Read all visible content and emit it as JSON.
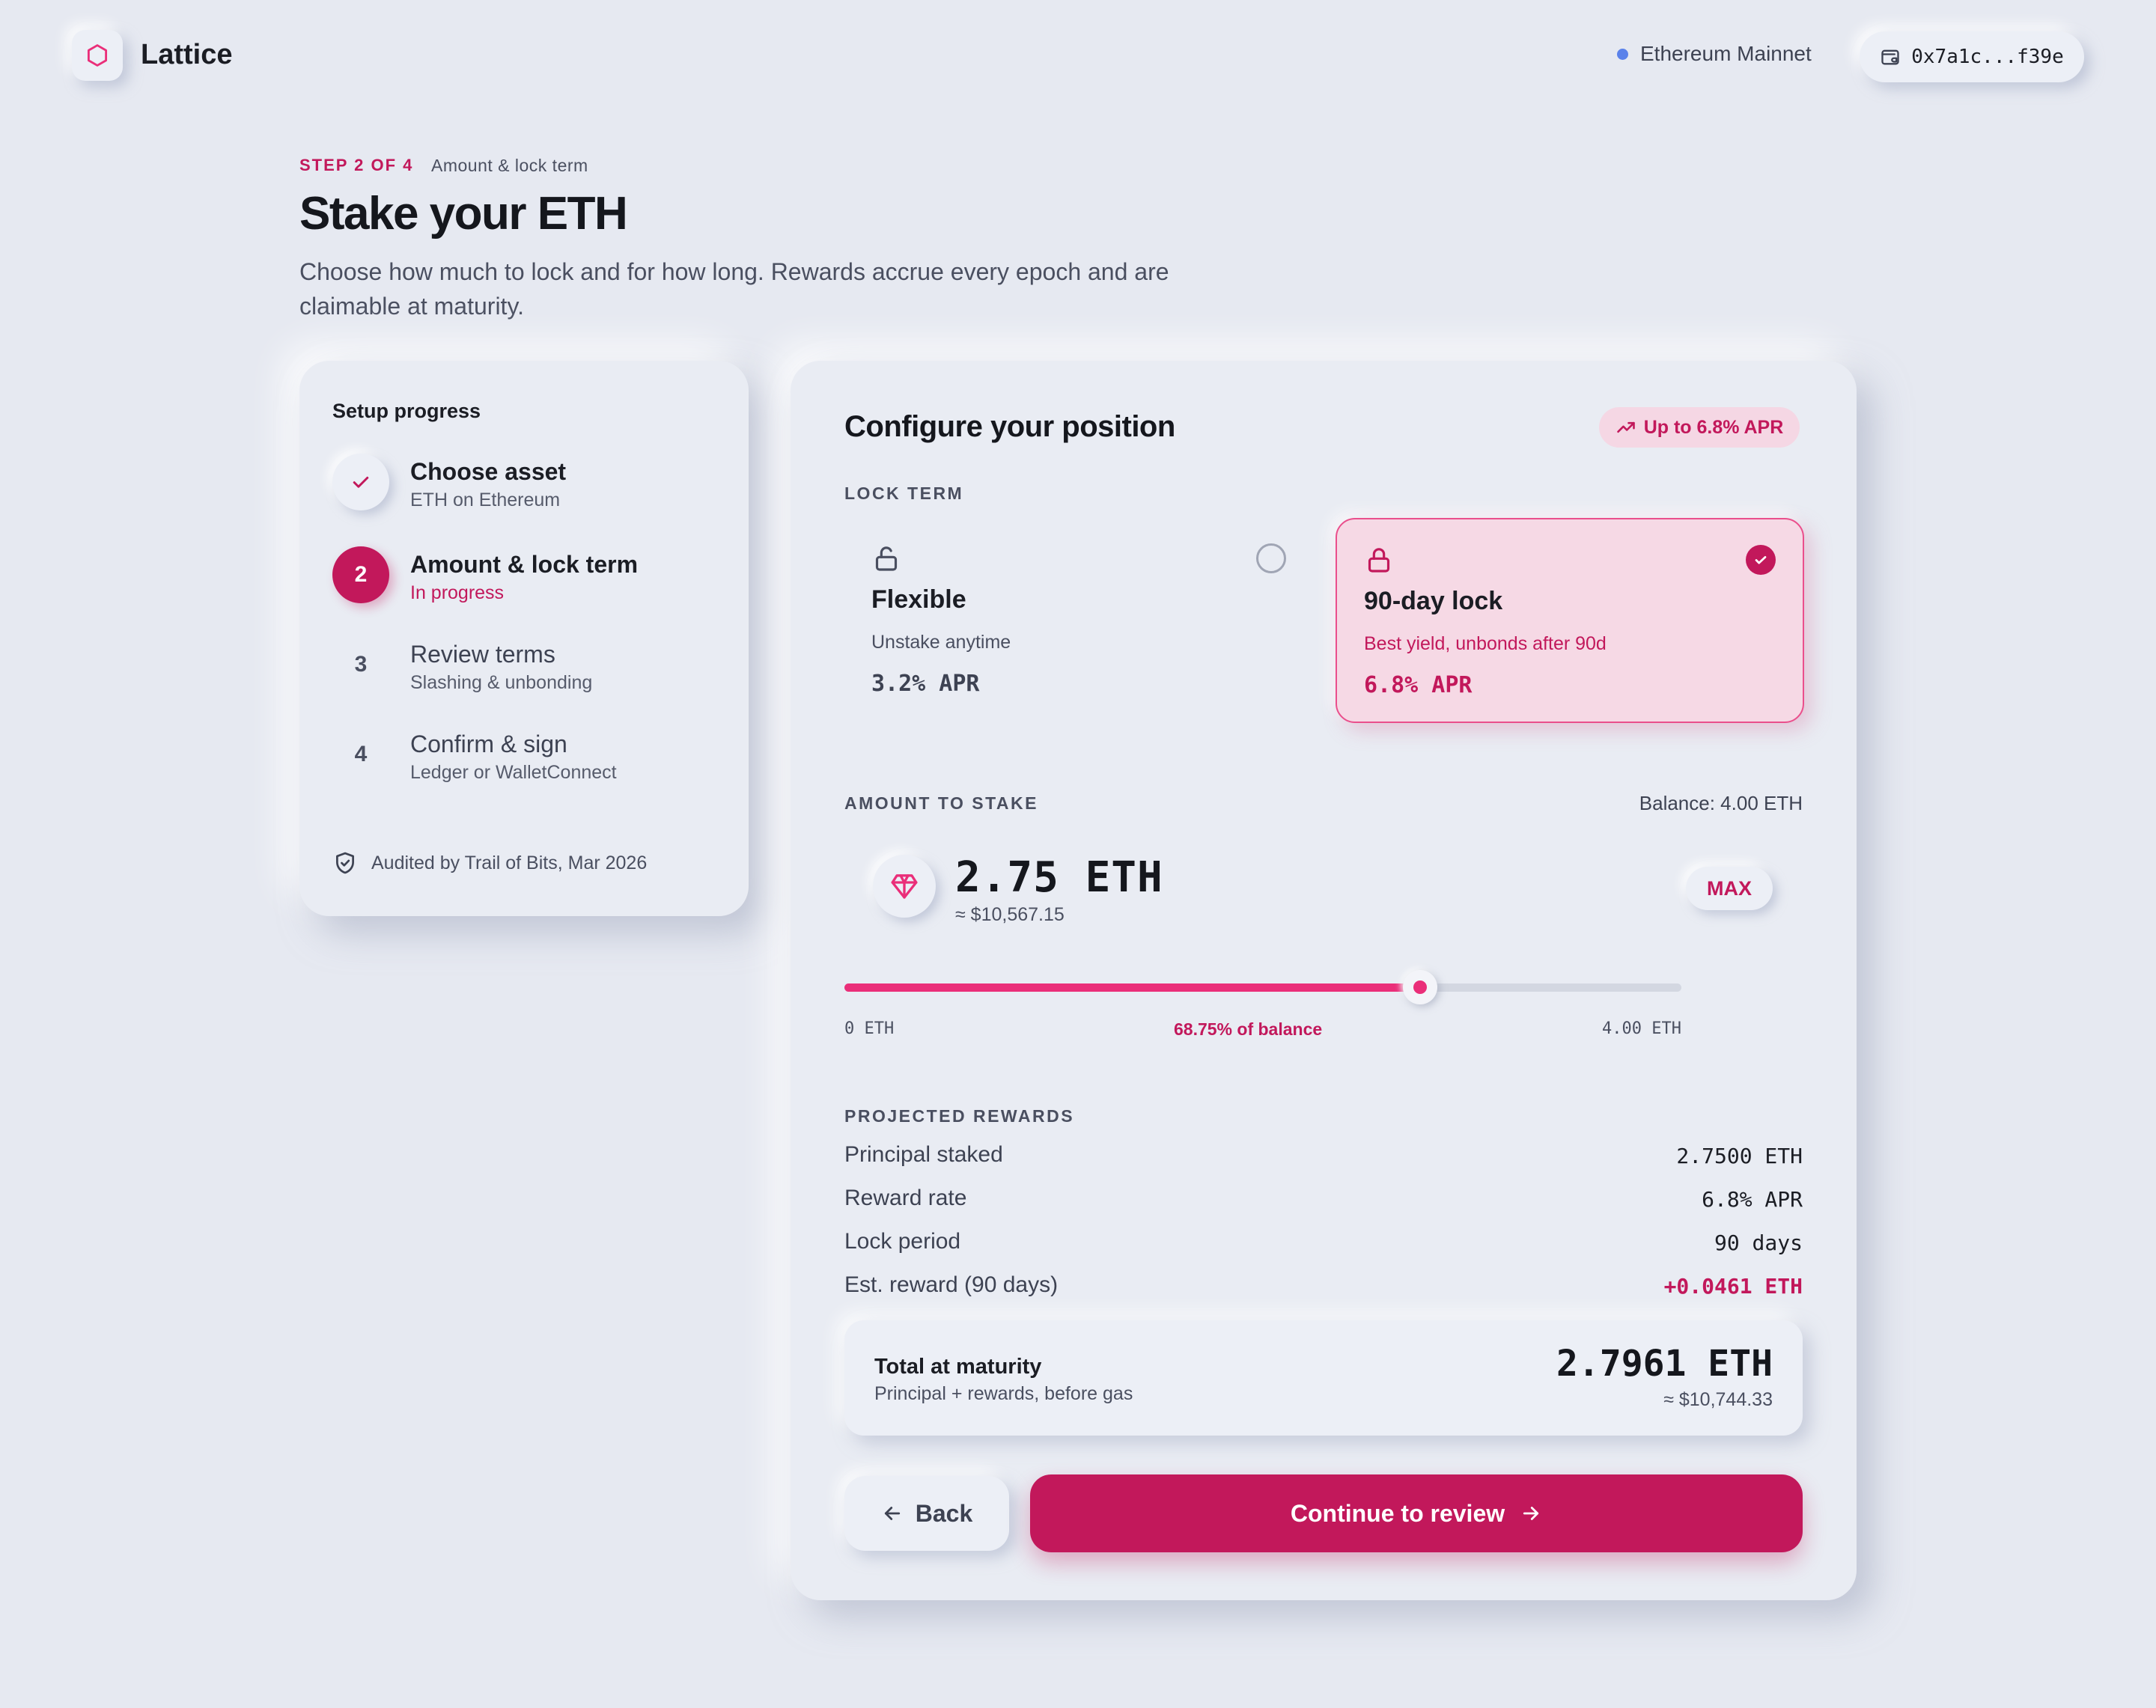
{
  "app": {
    "name": "Lattice",
    "network": "Ethereum Mainnet",
    "wallet_address": "0x7a1c...f39e"
  },
  "heading": {
    "step_label": "STEP 2 OF 4",
    "step_name": "Amount & lock term",
    "title": "Stake your ETH",
    "description": "Choose how much to lock and for how long. Rewards accrue every epoch and are claimable at maturity."
  },
  "progress": {
    "title": "Setup progress",
    "steps": [
      {
        "marker": "",
        "name": "Choose asset",
        "desc": "ETH on Ethereum",
        "status": "done"
      },
      {
        "marker": "2",
        "name": "Amount & lock term",
        "desc": "In progress",
        "status": "active"
      },
      {
        "marker": "3",
        "name": "Review terms",
        "desc": "Slashing & unbonding",
        "status": "pending"
      },
      {
        "marker": "4",
        "name": "Confirm & sign",
        "desc": "Ledger or WalletConnect",
        "status": "pending"
      }
    ],
    "audit_note": "Audited by Trail of Bits, Mar 2026"
  },
  "config": {
    "title": "Configure your position",
    "apr_badge": "Up to 6.8% APR",
    "lock_term_label": "LOCK TERM",
    "options": [
      {
        "name": "Flexible",
        "desc": "Unstake anytime",
        "apr": "3.2% APR",
        "selected": false
      },
      {
        "name": "90-day lock",
        "desc": "Best yield, unbonds after 90d",
        "apr": "6.8% APR",
        "selected": true
      }
    ],
    "amount_label": "AMOUNT TO STAKE",
    "balance": "Balance: 4.00 ETH",
    "amount": "2.75 ETH",
    "amount_usd": "≈ $10,567.15",
    "max_label": "MAX",
    "slider": {
      "min_label": "0 ETH",
      "max_label": "4.00 ETH",
      "percent_label": "68.75% of balance",
      "fraction": 0.6875
    }
  },
  "rewards": {
    "label": "PROJECTED REWARDS",
    "rows": [
      {
        "label": "Principal staked",
        "value": "2.7500 ETH"
      },
      {
        "label": "Reward rate",
        "value": "6.8% APR"
      },
      {
        "label": "Lock period",
        "value": "90 days"
      },
      {
        "label": "Est. reward (90 days)",
        "value": "+0.0461 ETH"
      }
    ],
    "total_title": "Total at maturity",
    "total_sub": "Principal + rewards, before gas",
    "total_value": "2.7961 ETH",
    "total_usd": "≈ $10,744.33"
  },
  "actions": {
    "back": "Back",
    "continue": "Continue to review"
  },
  "colors": {
    "accent": "#c2185b",
    "accent_bright": "#ea2e79",
    "background": "#e6e9f1",
    "network_dot": "#5b82ea"
  }
}
